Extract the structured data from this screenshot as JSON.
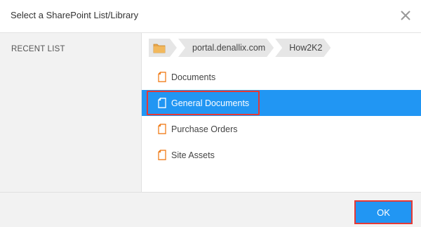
{
  "dialog": {
    "title": "Select a SharePoint List/Library"
  },
  "sidebar": {
    "label": "RECENT LIST"
  },
  "breadcrumb": {
    "items": [
      "portal.denallix.com",
      "How2K2"
    ]
  },
  "list": {
    "items": [
      {
        "label": "Documents",
        "selected": false
      },
      {
        "label": "General Documents",
        "selected": true
      },
      {
        "label": "Purchase Orders",
        "selected": false
      },
      {
        "label": "Site Assets",
        "selected": false
      }
    ]
  },
  "footer": {
    "ok_label": "OK"
  },
  "colors": {
    "accent": "#2196f3",
    "highlight": "#e53935",
    "icon": "#f07f1e"
  },
  "icons": {
    "close": "close-icon",
    "folder": "folder-icon",
    "document": "document-icon"
  }
}
